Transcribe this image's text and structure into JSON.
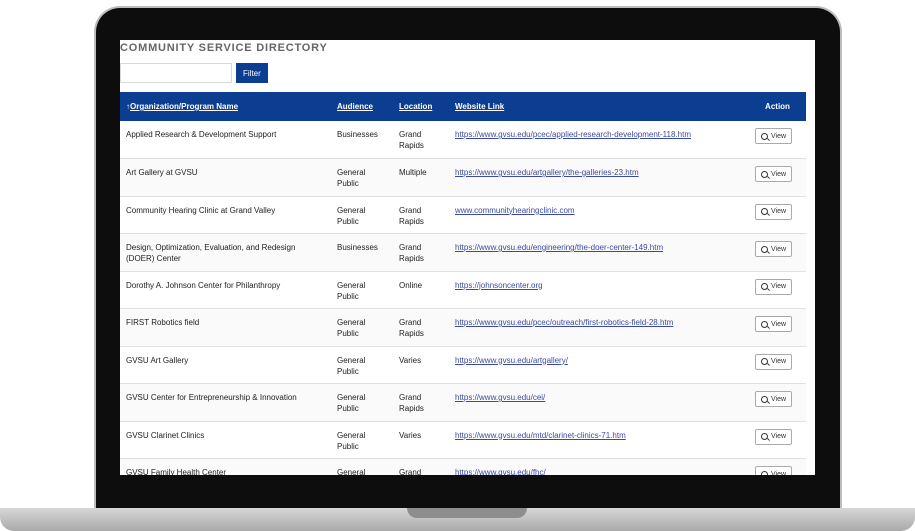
{
  "directory": {
    "title": "COMMUNITY SERVICE DIRECTORY",
    "filter_placeholder": "",
    "filter_label": "Filter"
  },
  "table": {
    "headers": {
      "sort_arrow": "↑",
      "name": "Organization/Program Name",
      "audience": "Audience",
      "location": "Location",
      "website": "Website Link",
      "action": "Action"
    },
    "view_label": "View",
    "rows": [
      {
        "name": "Applied Research & Development Support",
        "audience": "Businesses",
        "location": "Grand Rapids",
        "website": "https://www.gvsu.edu/pcec/applied-research-development-118.htm"
      },
      {
        "name": "Art Gallery at GVSU",
        "audience": "General Public",
        "location": "Multiple",
        "website": "https://www.gvsu.edu/artgallery/the-galleries-23.htm"
      },
      {
        "name": "Community Hearing Clinic at Grand Valley",
        "audience": "General Public",
        "location": "Grand Rapids",
        "website": "www.communityhearingclinic.com"
      },
      {
        "name": "Design, Optimization, Evaluation, and Redesign (DOER) Center",
        "audience": "Businesses",
        "location": "Grand Rapids",
        "website": "https://www.gvsu.edu/engineering/the-doer-center-149.htm"
      },
      {
        "name": "Dorothy A. Johnson Center for Philanthropy",
        "audience": "General Public",
        "location": "Online",
        "website": "https://johnsoncenter.org"
      },
      {
        "name": "FIRST Robotics field",
        "audience": "General Public",
        "location": "Grand Rapids",
        "website": "https://www.gvsu.edu/pcec/outreach/first-robotics-field-28.htm"
      },
      {
        "name": "GVSU Art Gallery",
        "audience": "General Public",
        "location": "Varies",
        "website": "https://www.gvsu.edu/artgallery/"
      },
      {
        "name": "GVSU Center for Entrepreneurship & Innovation",
        "audience": "General Public",
        "location": "Grand Rapids",
        "website": "https://www.gvsu.edu/cei/"
      },
      {
        "name": "GVSU Clarinet Clinics",
        "audience": "General Public",
        "location": "Varies",
        "website": "https://www.gvsu.edu/mtd/clarinet-clinics-71.htm"
      },
      {
        "name": "GVSU Family Health Center",
        "audience": "General",
        "location": "Grand",
        "website": "https://www.gvsu.edu/fhc/"
      }
    ]
  }
}
